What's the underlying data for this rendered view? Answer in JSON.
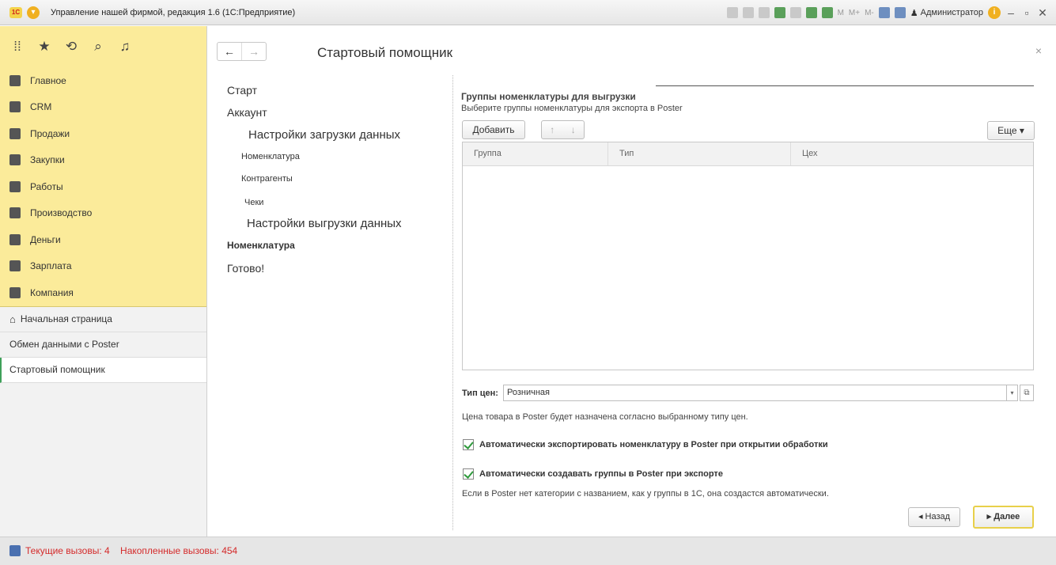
{
  "window": {
    "title": "Управление нашей фирмой, редакция 1.6  (1С:Предприятие)",
    "user": "Администратор"
  },
  "sidebar": {
    "sections": [
      {
        "label": "Главное",
        "icon": "list-icon"
      },
      {
        "label": "CRM",
        "icon": "crm-icon"
      },
      {
        "label": "Продажи",
        "icon": "sales-icon"
      },
      {
        "label": "Закупки",
        "icon": "purchases-icon"
      },
      {
        "label": "Работы",
        "icon": "tools-icon"
      },
      {
        "label": "Производство",
        "icon": "factory-icon"
      },
      {
        "label": "Деньги",
        "icon": "money-icon"
      },
      {
        "label": "Зарплата",
        "icon": "people-icon"
      },
      {
        "label": "Компания",
        "icon": "flag-icon"
      }
    ],
    "home": "Начальная страница",
    "open_windows": [
      "Обмен данными с Poster",
      "Стартовый помощник"
    ]
  },
  "form": {
    "title": "Стартовый помощник"
  },
  "steps": {
    "start": "Старт",
    "account": "Аккаунт",
    "load_settings": "Настройки загрузки данных",
    "load_nomenclature": "Номенклатура",
    "load_contractors": "Контрагенты",
    "load_checks": "Чеки",
    "export_settings": "Настройки выгрузки данных",
    "export_nomenclature": "Номенклатура",
    "done": "Готово!"
  },
  "groups": {
    "title": "Группы номенклатуры для выгрузки",
    "description": "Выберите группы номенклатуры для экспорта в Poster",
    "add_button": "Добавить",
    "more_button": "Еще",
    "columns": [
      "Группа",
      "Тип",
      "Цех"
    ]
  },
  "price": {
    "label": "Тип цен:",
    "value": "Розничная",
    "note": "Цена товара в Poster будет назначена согласно выбранному типу цен."
  },
  "options": {
    "auto_export_label": "Автоматически экспортировать номенклатуру в Poster при открытии обработки",
    "auto_export_checked": true,
    "auto_groups_label": "Автоматически создавать группы в Poster при экспорте",
    "auto_groups_checked": true,
    "auto_groups_note": "Если в Poster нет категории с названием, как у группы в 1С, она создастся автоматически."
  },
  "footer": {
    "back": "Назад",
    "next": "Далее"
  },
  "status": {
    "current_calls": "Текущие вызовы: 4",
    "accumulated_calls": "Накопленные вызовы: 454"
  }
}
